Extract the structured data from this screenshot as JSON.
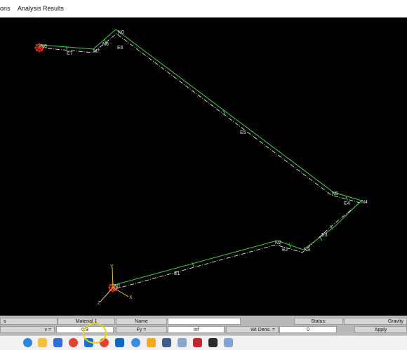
{
  "menu": [
    "ons",
    "Analysis",
    "Results"
  ],
  "canvas": {
    "nodes": [
      "N8",
      "N7",
      "N6",
      "N0",
      "N5",
      "N4",
      "N3",
      "N2",
      "N1"
    ],
    "elements": [
      "E7",
      "E6",
      "E5",
      "E4",
      "E3",
      "E2",
      "E1"
    ],
    "axes": {
      "x": "X",
      "y": "Y",
      "z": "Z"
    }
  },
  "panel": {
    "row1": {
      "left": "s",
      "material": "Material 1",
      "name_label": "Name",
      "name_value": "",
      "status_label": "Status:",
      "status_value": "",
      "gravity": "Gravity"
    },
    "row2": {
      "nu_label": "v =",
      "nu_value": "0.3",
      "fy_label": "Fy =",
      "fy_value": "inf",
      "wtdens_label": "Wt Dens. =",
      "wtdens_value": "0",
      "apply": "Apply"
    }
  },
  "taskbar": {
    "icons": [
      "edge-icon",
      "file-explorer-icon",
      "app-icon",
      "chrome-icon",
      "outlook-icon",
      "office-icon",
      "mail-icon",
      "signal-icon",
      "paint-icon",
      "calculator-icon",
      "snipping-icon",
      "app-red-icon",
      "terminal-icon",
      "app-window-icon"
    ]
  },
  "colors": {
    "members": "#3fd23f",
    "local_axes": "#ffffff",
    "support": "#ff3020",
    "canvas": "#000000"
  }
}
